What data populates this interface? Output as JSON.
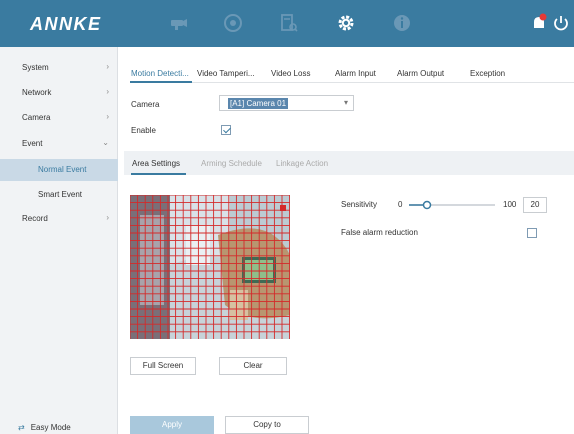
{
  "brand": "ANNKE",
  "header": {
    "icons": [
      "camera-icon",
      "playback-icon",
      "search-icon",
      "gear-icon",
      "info-icon",
      "alarm-bell-icon",
      "power-icon"
    ]
  },
  "sidebar": {
    "items": [
      {
        "label": "System",
        "chevron": "›"
      },
      {
        "label": "Network",
        "chevron": "›"
      },
      {
        "label": "Camera",
        "chevron": "›"
      },
      {
        "label": "Event",
        "chevron": "⌄"
      },
      {
        "label": "Normal Event"
      },
      {
        "label": "Smart Event"
      },
      {
        "label": "Record",
        "chevron": "›"
      }
    ],
    "easy_mode": "Easy Mode",
    "easy_mode_icon": "⇄"
  },
  "tabs": [
    "Motion Detecti...",
    "Video Tamperi...",
    "Video Loss",
    "Alarm Input",
    "Alarm Output",
    "Exception"
  ],
  "camera": {
    "label": "Camera",
    "value": "[A1] Camera 01",
    "caret": "▾"
  },
  "enable": {
    "label": "Enable",
    "checked": true
  },
  "subtabs": [
    "Area Settings",
    "Arming Schedule",
    "Linkage Action"
  ],
  "sensitivity": {
    "label": "Sensitivity",
    "min": "0",
    "max": "100",
    "value": "20"
  },
  "false_alarm": {
    "label": "False alarm reduction",
    "checked": false
  },
  "buttons": {
    "full_screen": "Full Screen",
    "clear": "Clear",
    "apply": "Apply",
    "copy_to": "Copy to"
  },
  "colors": {
    "accent": "#3a7ba0",
    "grid": "#d42a2a",
    "apply_disabled": "#a9c8dc"
  }
}
